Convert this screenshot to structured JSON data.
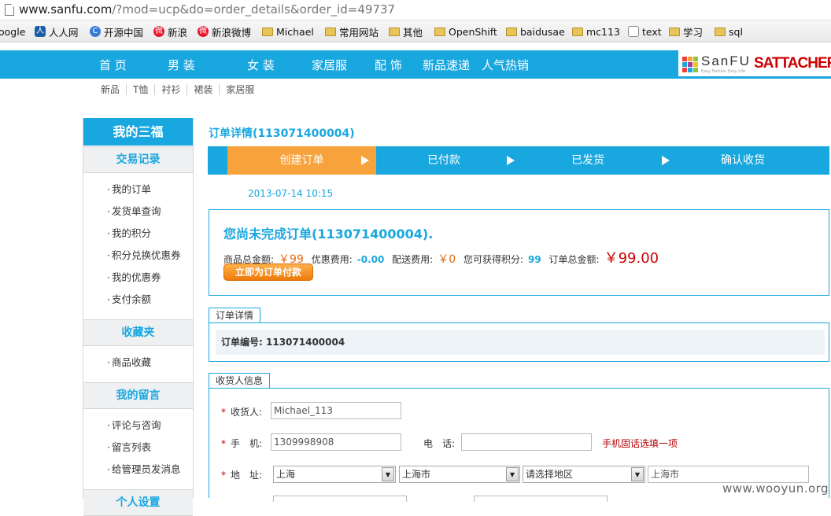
{
  "browser": {
    "url_host": "www.sanfu.com",
    "url_rest": "/?mod=ucp&do=order_details&order_id=49737",
    "bookmarks": [
      "oogle",
      "人人网",
      "开源中国",
      "新浪",
      "新浪微博",
      "Michael",
      "常用网站",
      "其他",
      "OpenShift",
      "baidusae",
      "mc113",
      "text",
      "学习",
      "sql"
    ]
  },
  "nav": {
    "items": [
      "首 页",
      "男 装",
      "女 装",
      "家居服",
      "配 饰",
      "新品速递",
      "人气热销"
    ]
  },
  "brand": {
    "logo_text": "SanFU",
    "tagline": "Easy Fashion Easy Life",
    "logo2": "SATTACHERA"
  },
  "subnav": [
    "新品",
    "T恤",
    "衬衫",
    "裙装",
    "家居服"
  ],
  "sidebar": {
    "title": "我的三福",
    "sections": [
      {
        "title": "交易记录",
        "items": [
          "我的订单",
          "发货单查询",
          "我的积分",
          "积分兑换优惠券",
          "我的优惠券",
          "支付余额"
        ]
      },
      {
        "title": "收藏夹",
        "items": [
          "商品收藏"
        ]
      },
      {
        "title": "我的留言",
        "items": [
          "评论与咨询",
          "留言列表",
          "给管理员发消息"
        ]
      },
      {
        "title": "个人设置",
        "items": []
      }
    ]
  },
  "order": {
    "title": "订单详情(113071400004)",
    "steps": [
      "创建订单",
      "已付款",
      "已发货",
      "确认收货"
    ],
    "active_step": 0,
    "date": "2013-07-14 10:15",
    "notice": "您尚未完成订单(113071400004).",
    "goods_label": "商品总金额:",
    "goods_amount": "￥99",
    "discount_label": "优惠费用:",
    "discount_amount": "-0.00",
    "shipping_label": "配送费用:",
    "shipping_amount": "￥0",
    "points_label": "您可获得积分:",
    "points": "99",
    "total_label": "订单总金额:",
    "total_amount": "￥99.00",
    "pay_button": "立即为订单付款",
    "detail_legend": "订单详情",
    "order_no_label": "订单编号:",
    "order_no": "113071400004"
  },
  "receiver": {
    "legend": "收货人信息",
    "name_label": "收货人:",
    "name_value": "Michael_113",
    "mobile_label": "手　机:",
    "mobile_value": "1309998908",
    "phone_label": "电　话:",
    "phone_value": "",
    "hint": "手机固话选填一项",
    "address_label": "地　址:",
    "province": "上海",
    "city": "上海市",
    "district": "请选择地区",
    "address_value": "上海市"
  },
  "watermark": "www.wooyun.org",
  "colors": {
    "accent": "#19a7e0",
    "active_step": "#f7a23a",
    "price_red": "#cc0000"
  }
}
